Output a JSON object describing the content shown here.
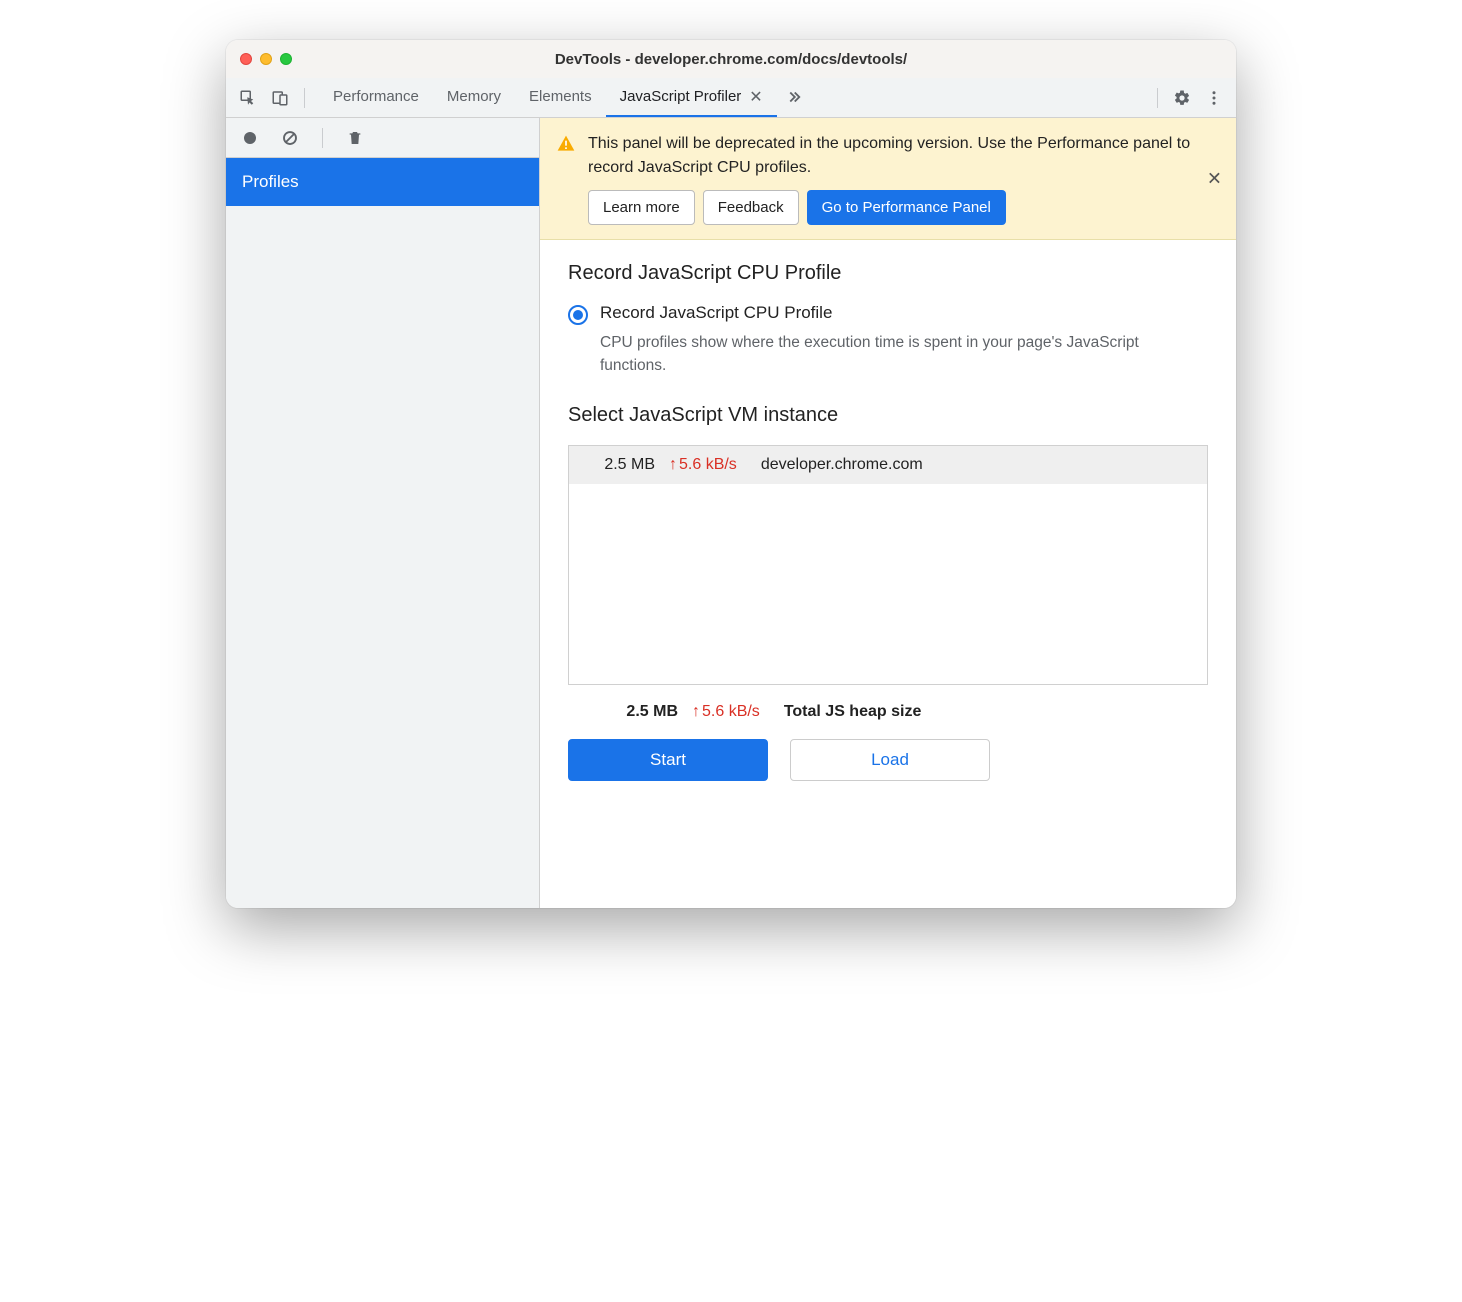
{
  "window": {
    "title": "DevTools - developer.chrome.com/docs/devtools/"
  },
  "tabs": {
    "items": [
      {
        "label": "Performance"
      },
      {
        "label": "Memory"
      },
      {
        "label": "Elements"
      },
      {
        "label": "JavaScript Profiler"
      }
    ],
    "active_index": 3
  },
  "sidebar": {
    "items": [
      {
        "label": "Profiles"
      }
    ]
  },
  "banner": {
    "text": "This panel will be deprecated in the upcoming version. Use the Performance panel to record JavaScript CPU profiles.",
    "learn_more": "Learn more",
    "feedback": "Feedback",
    "go_to_perf": "Go to Performance Panel"
  },
  "content": {
    "heading_record": "Record JavaScript CPU Profile",
    "radio_label": "Record JavaScript CPU Profile",
    "radio_desc": "CPU profiles show where the execution time is spent in your page's JavaScript functions.",
    "heading_vm": "Select JavaScript VM instance",
    "vm_instances": [
      {
        "size": "2.5 MB",
        "rate": "5.6 kB/s",
        "host": "developer.chrome.com"
      }
    ],
    "totals": {
      "size": "2.5 MB",
      "rate": "5.6 kB/s",
      "label": "Total JS heap size"
    },
    "start_label": "Start",
    "load_label": "Load"
  }
}
